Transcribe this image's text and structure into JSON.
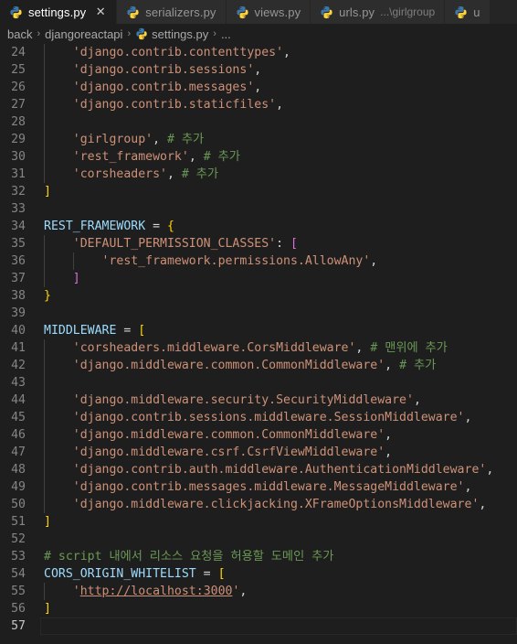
{
  "window": {
    "app": "Visual Studio Code",
    "theme": "dark-plus",
    "colors": {
      "editor_bg": "#1e1e1e",
      "tabbar_bg": "#252526",
      "tab_inactive_bg": "#2d2d2d",
      "tab_active_fg": "#ffffff",
      "tab_inactive_fg": "#969696",
      "lineno_fg": "#858585",
      "lineno_active_fg": "#c6c6c6",
      "string": "#ce9178",
      "comment": "#6a9955",
      "variable": "#9cdcfe",
      "bracket_yellow": "#ffd700",
      "bracket_magenta": "#da70d6",
      "indent_guide": "#404040",
      "python_icon_blue": "#3c78aa",
      "python_icon_yellow": "#ffd43b"
    }
  },
  "tabs": [
    {
      "label": "settings.py",
      "description": "",
      "icon": "python-file-icon",
      "active": true,
      "close_glyph": "✕",
      "has_close": true
    },
    {
      "label": "serializers.py",
      "description": "",
      "icon": "python-file-icon",
      "active": false,
      "close_glyph": "✕",
      "has_close": false
    },
    {
      "label": "views.py",
      "description": "",
      "icon": "python-file-icon",
      "active": false,
      "close_glyph": "✕",
      "has_close": false
    },
    {
      "label": "urls.py",
      "description": "...\\girlgroup",
      "icon": "python-file-icon",
      "active": false,
      "close_glyph": "✕",
      "has_close": false
    },
    {
      "label": "u",
      "description": "",
      "icon": "python-file-icon",
      "active": false,
      "close_glyph": "✕",
      "has_close": false
    }
  ],
  "breadcrumb": {
    "separator": "›",
    "items": [
      {
        "label": "back",
        "icon": ""
      },
      {
        "label": "djangoreactapi",
        "icon": ""
      },
      {
        "label": "settings.py",
        "icon": "python-file-icon"
      },
      {
        "label": "...",
        "icon": ""
      }
    ]
  },
  "editor": {
    "filename": "settings.py",
    "language": "Python",
    "first_visible_line": 24,
    "current_line": 57,
    "lines": [
      {
        "n": 24,
        "indent_guides": [
          1
        ],
        "tokens": [
          {
            "t": "    ",
            "c": "t-op"
          },
          {
            "t": "'django.contrib.contenttypes'",
            "c": "t-str"
          },
          {
            "t": ",",
            "c": "t-op"
          }
        ]
      },
      {
        "n": 25,
        "indent_guides": [
          1
        ],
        "tokens": [
          {
            "t": "    ",
            "c": "t-op"
          },
          {
            "t": "'django.contrib.sessions'",
            "c": "t-str"
          },
          {
            "t": ",",
            "c": "t-op"
          }
        ]
      },
      {
        "n": 26,
        "indent_guides": [
          1
        ],
        "tokens": [
          {
            "t": "    ",
            "c": "t-op"
          },
          {
            "t": "'django.contrib.messages'",
            "c": "t-str"
          },
          {
            "t": ",",
            "c": "t-op"
          }
        ]
      },
      {
        "n": 27,
        "indent_guides": [
          1
        ],
        "tokens": [
          {
            "t": "    ",
            "c": "t-op"
          },
          {
            "t": "'django.contrib.staticfiles'",
            "c": "t-str"
          },
          {
            "t": ",",
            "c": "t-op"
          }
        ]
      },
      {
        "n": 28,
        "indent_guides": [
          1
        ],
        "tokens": []
      },
      {
        "n": 29,
        "indent_guides": [
          1
        ],
        "tokens": [
          {
            "t": "    ",
            "c": "t-op"
          },
          {
            "t": "'girlgroup'",
            "c": "t-str"
          },
          {
            "t": ",",
            "c": "t-op"
          },
          {
            "t": " ",
            "c": "t-op"
          },
          {
            "t": "# 추가",
            "c": "t-com"
          }
        ]
      },
      {
        "n": 30,
        "indent_guides": [
          1
        ],
        "tokens": [
          {
            "t": "    ",
            "c": "t-op"
          },
          {
            "t": "'rest_framework'",
            "c": "t-str"
          },
          {
            "t": ",",
            "c": "t-op"
          },
          {
            "t": " ",
            "c": "t-op"
          },
          {
            "t": "# 추가",
            "c": "t-com"
          }
        ]
      },
      {
        "n": 31,
        "indent_guides": [
          1
        ],
        "tokens": [
          {
            "t": "    ",
            "c": "t-op"
          },
          {
            "t": "'corsheaders'",
            "c": "t-str"
          },
          {
            "t": ",",
            "c": "t-op"
          },
          {
            "t": " ",
            "c": "t-op"
          },
          {
            "t": "# 추가",
            "c": "t-com"
          }
        ]
      },
      {
        "n": 32,
        "indent_guides": [],
        "tokens": [
          {
            "t": "]",
            "c": "t-b1"
          }
        ]
      },
      {
        "n": 33,
        "indent_guides": [],
        "tokens": []
      },
      {
        "n": 34,
        "indent_guides": [],
        "tokens": [
          {
            "t": "REST_FRAMEWORK",
            "c": "t-var"
          },
          {
            "t": " = ",
            "c": "t-op"
          },
          {
            "t": "{",
            "c": "t-b1"
          }
        ]
      },
      {
        "n": 35,
        "indent_guides": [
          1
        ],
        "tokens": [
          {
            "t": "    ",
            "c": "t-op"
          },
          {
            "t": "'DEFAULT_PERMISSION_CLASSES'",
            "c": "t-str"
          },
          {
            "t": ": ",
            "c": "t-op"
          },
          {
            "t": "[",
            "c": "t-b2"
          }
        ]
      },
      {
        "n": 36,
        "indent_guides": [
          1,
          2
        ],
        "tokens": [
          {
            "t": "        ",
            "c": "t-op"
          },
          {
            "t": "'rest_framework.permissions.AllowAny'",
            "c": "t-str"
          },
          {
            "t": ",",
            "c": "t-op"
          }
        ]
      },
      {
        "n": 37,
        "indent_guides": [
          1
        ],
        "tokens": [
          {
            "t": "    ",
            "c": "t-op"
          },
          {
            "t": "]",
            "c": "t-b2"
          }
        ]
      },
      {
        "n": 38,
        "indent_guides": [],
        "tokens": [
          {
            "t": "}",
            "c": "t-b1"
          }
        ]
      },
      {
        "n": 39,
        "indent_guides": [],
        "tokens": []
      },
      {
        "n": 40,
        "indent_guides": [],
        "tokens": [
          {
            "t": "MIDDLEWARE",
            "c": "t-var"
          },
          {
            "t": " = ",
            "c": "t-op"
          },
          {
            "t": "[",
            "c": "t-b1"
          }
        ]
      },
      {
        "n": 41,
        "indent_guides": [
          1
        ],
        "tokens": [
          {
            "t": "    ",
            "c": "t-op"
          },
          {
            "t": "'corsheaders.middleware.CorsMiddleware'",
            "c": "t-str"
          },
          {
            "t": ",",
            "c": "t-op"
          },
          {
            "t": " ",
            "c": "t-op"
          },
          {
            "t": "# 맨위에 추가",
            "c": "t-com"
          }
        ]
      },
      {
        "n": 42,
        "indent_guides": [
          1
        ],
        "tokens": [
          {
            "t": "    ",
            "c": "t-op"
          },
          {
            "t": "'django.middleware.common.CommonMiddleware'",
            "c": "t-str"
          },
          {
            "t": ",",
            "c": "t-op"
          },
          {
            "t": " ",
            "c": "t-op"
          },
          {
            "t": "# 추가",
            "c": "t-com"
          }
        ]
      },
      {
        "n": 43,
        "indent_guides": [
          1
        ],
        "tokens": []
      },
      {
        "n": 44,
        "indent_guides": [
          1
        ],
        "tokens": [
          {
            "t": "    ",
            "c": "t-op"
          },
          {
            "t": "'django.middleware.security.SecurityMiddleware'",
            "c": "t-str"
          },
          {
            "t": ",",
            "c": "t-op"
          }
        ]
      },
      {
        "n": 45,
        "indent_guides": [
          1
        ],
        "tokens": [
          {
            "t": "    ",
            "c": "t-op"
          },
          {
            "t": "'django.contrib.sessions.middleware.SessionMiddleware'",
            "c": "t-str"
          },
          {
            "t": ",",
            "c": "t-op"
          }
        ]
      },
      {
        "n": 46,
        "indent_guides": [
          1
        ],
        "tokens": [
          {
            "t": "    ",
            "c": "t-op"
          },
          {
            "t": "'django.middleware.common.CommonMiddleware'",
            "c": "t-str"
          },
          {
            "t": ",",
            "c": "t-op"
          }
        ]
      },
      {
        "n": 47,
        "indent_guides": [
          1
        ],
        "tokens": [
          {
            "t": "    ",
            "c": "t-op"
          },
          {
            "t": "'django.middleware.csrf.CsrfViewMiddleware'",
            "c": "t-str"
          },
          {
            "t": ",",
            "c": "t-op"
          }
        ]
      },
      {
        "n": 48,
        "indent_guides": [
          1
        ],
        "tokens": [
          {
            "t": "    ",
            "c": "t-op"
          },
          {
            "t": "'django.contrib.auth.middleware.AuthenticationMiddleware'",
            "c": "t-str"
          },
          {
            "t": ",",
            "c": "t-op"
          }
        ]
      },
      {
        "n": 49,
        "indent_guides": [
          1
        ],
        "tokens": [
          {
            "t": "    ",
            "c": "t-op"
          },
          {
            "t": "'django.contrib.messages.middleware.MessageMiddleware'",
            "c": "t-str"
          },
          {
            "t": ",",
            "c": "t-op"
          }
        ]
      },
      {
        "n": 50,
        "indent_guides": [
          1
        ],
        "tokens": [
          {
            "t": "    ",
            "c": "t-op"
          },
          {
            "t": "'django.middleware.clickjacking.XFrameOptionsMiddleware'",
            "c": "t-str"
          },
          {
            "t": ",",
            "c": "t-op"
          }
        ]
      },
      {
        "n": 51,
        "indent_guides": [],
        "tokens": [
          {
            "t": "]",
            "c": "t-b1"
          }
        ]
      },
      {
        "n": 52,
        "indent_guides": [],
        "tokens": []
      },
      {
        "n": 53,
        "indent_guides": [],
        "tokens": [
          {
            "t": "# script 내에서 리소스 요청을 허용할 도메인 추가",
            "c": "t-com"
          }
        ]
      },
      {
        "n": 54,
        "indent_guides": [],
        "tokens": [
          {
            "t": "CORS_ORIGIN_WHITELIST",
            "c": "t-var"
          },
          {
            "t": " = ",
            "c": "t-op"
          },
          {
            "t": "[",
            "c": "t-b1"
          }
        ]
      },
      {
        "n": 55,
        "indent_guides": [
          1
        ],
        "tokens": [
          {
            "t": "    ",
            "c": "t-op"
          },
          {
            "t": "'",
            "c": "t-str"
          },
          {
            "t": "http://localhost:3000",
            "c": "t-link"
          },
          {
            "t": "'",
            "c": "t-str"
          },
          {
            "t": ",",
            "c": "t-op"
          }
        ]
      },
      {
        "n": 56,
        "indent_guides": [],
        "tokens": [
          {
            "t": "]",
            "c": "t-b1"
          }
        ]
      },
      {
        "n": 57,
        "indent_guides": [],
        "tokens": []
      }
    ]
  }
}
